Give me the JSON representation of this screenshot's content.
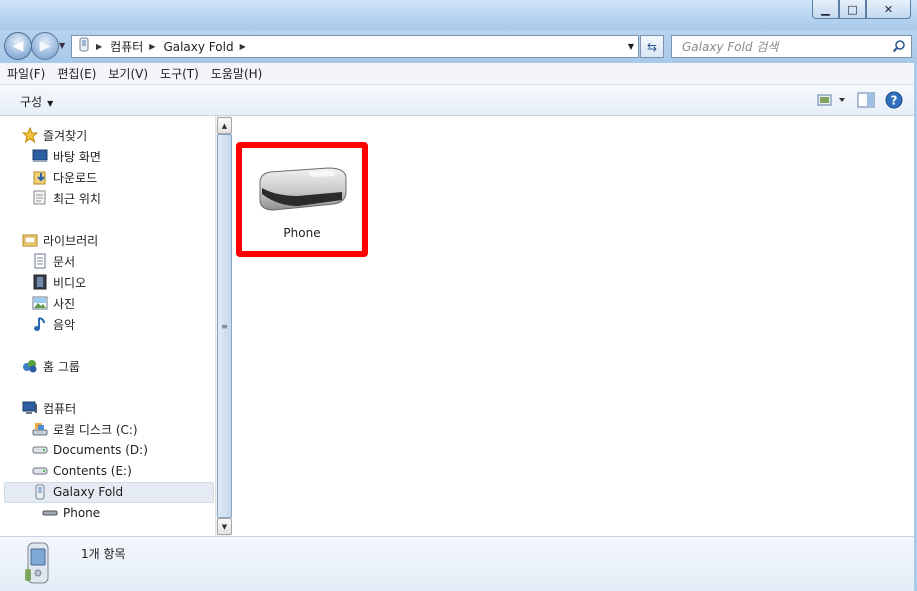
{
  "window": {
    "minimize_label": "▁",
    "maximize_label": "□",
    "close_label": "✕"
  },
  "address_bar": {
    "crumbs": [
      "컴퓨터",
      "Galaxy Fold"
    ]
  },
  "search": {
    "placeholder": "Galaxy Fold 검색"
  },
  "menu": {
    "items": [
      "파일(F)",
      "편집(E)",
      "보기(V)",
      "도구(T)",
      "도움말(H)"
    ]
  },
  "toolbar": {
    "organize_label": "구성"
  },
  "nav_pane": {
    "favorites": {
      "label": "즐겨찾기",
      "items": [
        "바탕 화면",
        "다운로드",
        "최근 위치"
      ]
    },
    "libraries": {
      "label": "라이브러리",
      "items": [
        "문서",
        "비디오",
        "사진",
        "음악"
      ]
    },
    "homegroup": {
      "label": "홈 그룹"
    },
    "computer": {
      "label": "컴퓨터",
      "items": [
        "로컬 디스크 (C:)",
        "Documents (D:)",
        "Contents (E:)",
        "Galaxy Fold"
      ],
      "sub_items": [
        "Phone"
      ]
    }
  },
  "content": {
    "items": [
      {
        "label": "Phone",
        "icon": "removable-drive-icon",
        "highlighted": true
      }
    ]
  },
  "details": {
    "count_text": "1개 항목"
  },
  "colors": {
    "highlight": "#ff0000",
    "titlebar": "#b6d3ee"
  }
}
